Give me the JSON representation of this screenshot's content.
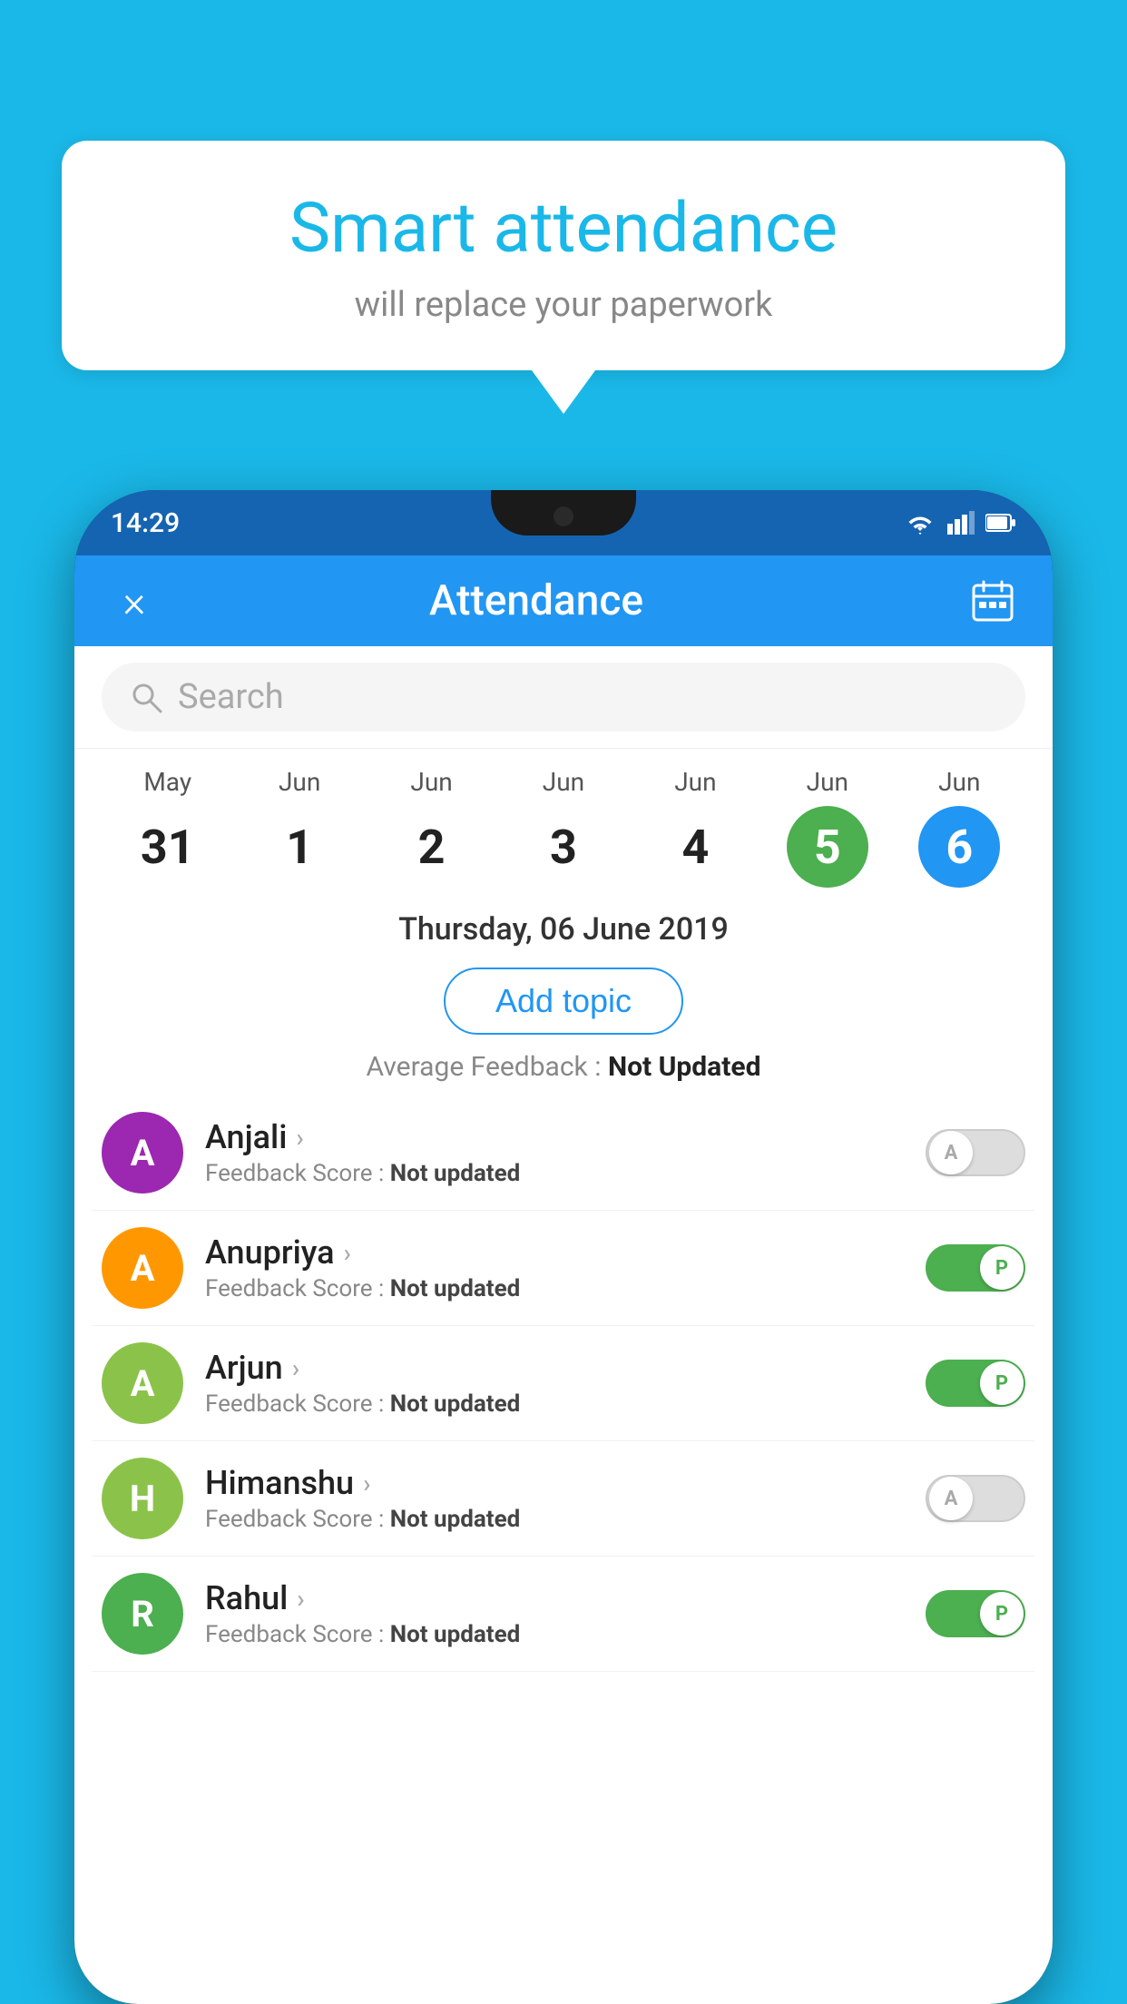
{
  "background_color": "#1ab8e8",
  "bubble": {
    "title": "Smart attendance",
    "subtitle": "will replace your paperwork"
  },
  "status_bar": {
    "time": "14:29"
  },
  "app_bar": {
    "title": "Attendance",
    "close_label": "×",
    "calendar_icon": "calendar-icon"
  },
  "search": {
    "placeholder": "Search"
  },
  "calendar": {
    "days": [
      {
        "month": "May",
        "num": "31",
        "state": "normal"
      },
      {
        "month": "Jun",
        "num": "1",
        "state": "normal"
      },
      {
        "month": "Jun",
        "num": "2",
        "state": "normal"
      },
      {
        "month": "Jun",
        "num": "3",
        "state": "normal"
      },
      {
        "month": "Jun",
        "num": "4",
        "state": "normal"
      },
      {
        "month": "Jun",
        "num": "5",
        "state": "today"
      },
      {
        "month": "Jun",
        "num": "6",
        "state": "selected"
      }
    ]
  },
  "selected_date": "Thursday, 06 June 2019",
  "add_topic_label": "Add topic",
  "feedback_avg_label": "Average Feedback :",
  "feedback_avg_value": "Not Updated",
  "students": [
    {
      "name": "Anjali",
      "avatar_letter": "A",
      "avatar_color": "#9c27b0",
      "feedback_label": "Feedback Score :",
      "feedback_value": "Not updated",
      "toggle_state": "off",
      "toggle_letter": "A"
    },
    {
      "name": "Anupriya",
      "avatar_letter": "A",
      "avatar_color": "#ff9800",
      "feedback_label": "Feedback Score :",
      "feedback_value": "Not updated",
      "toggle_state": "on",
      "toggle_letter": "P"
    },
    {
      "name": "Arjun",
      "avatar_letter": "A",
      "avatar_color": "#8bc34a",
      "feedback_label": "Feedback Score :",
      "feedback_value": "Not updated",
      "toggle_state": "on",
      "toggle_letter": "P"
    },
    {
      "name": "Himanshu",
      "avatar_letter": "H",
      "avatar_color": "#8bc34a",
      "feedback_label": "Feedback Score :",
      "feedback_value": "Not updated",
      "toggle_state": "off",
      "toggle_letter": "A"
    },
    {
      "name": "Rahul",
      "avatar_letter": "R",
      "avatar_color": "#4caf50",
      "feedback_label": "Feedback Score :",
      "feedback_value": "Not updated",
      "toggle_state": "on",
      "toggle_letter": "P"
    }
  ]
}
